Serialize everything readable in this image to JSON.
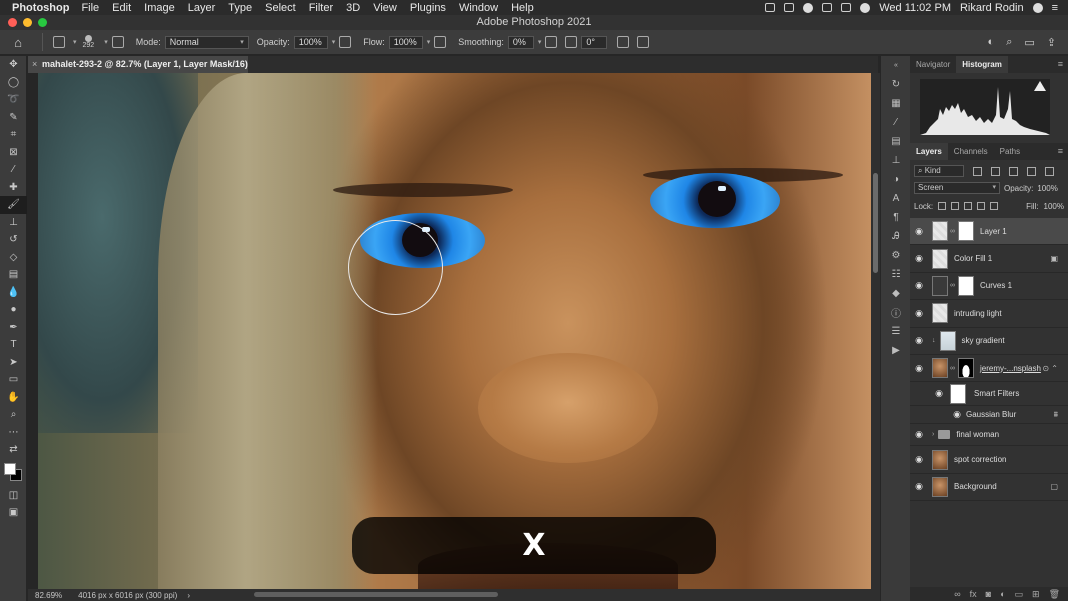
{
  "menubar": {
    "app_name": "Photoshop",
    "items": [
      "File",
      "Edit",
      "Image",
      "Layer",
      "Type",
      "Select",
      "Filter",
      "3D",
      "View",
      "Plugins",
      "Window",
      "Help"
    ],
    "clock": "Wed 11:02 PM",
    "user": "Rikard Rodin"
  },
  "window": {
    "title": "Adobe Photoshop 2021"
  },
  "options": {
    "brush_size": "292",
    "mode_label": "Mode:",
    "mode_value": "Normal",
    "opacity_label": "Opacity:",
    "opacity_value": "100%",
    "flow_label": "Flow:",
    "flow_value": "100%",
    "smoothing_label": "Smoothing:",
    "smoothing_value": "0%",
    "angle_value": "0°"
  },
  "document": {
    "tab_title": "mahalet-293-2 @ 82.7% (Layer 1, Layer Mask/16) *",
    "close": "×"
  },
  "caption": {
    "text": "X"
  },
  "status": {
    "zoom": "82.69%",
    "doc_info": "4016 px x 6016 px (300 ppi)",
    "arrow": "›"
  },
  "panels": {
    "top_tabs": [
      "Navigator",
      "Histogram"
    ],
    "layers_tabs": [
      "Layers",
      "Channels",
      "Paths"
    ],
    "kind_label": "Kind",
    "blend_mode": "Screen",
    "opacity_label": "Opacity:",
    "opacity_value": "100%",
    "lock_label": "Lock:",
    "fill_label": "Fill:",
    "fill_value": "100%",
    "layers": [
      {
        "name": "Layer 1"
      },
      {
        "name": "Color Fill 1"
      },
      {
        "name": "Curves 1"
      },
      {
        "name": "intruding light"
      },
      {
        "name": "sky gradient"
      },
      {
        "name": "jeremy-...nsplash"
      },
      {
        "name": "Smart Filters"
      },
      {
        "name": "Gaussian Blur"
      },
      {
        "name": "final woman"
      },
      {
        "name": "spot correction"
      },
      {
        "name": "Background"
      }
    ]
  },
  "icons": {
    "eye": "👁",
    "home": "⌂",
    "lock": "🔒",
    "chain": "∞"
  },
  "colors": {
    "traffic_red": "#ff5f57",
    "traffic_yellow": "#febc2e",
    "traffic_green": "#28c840",
    "selected_layer": "#4a4a4a"
  }
}
